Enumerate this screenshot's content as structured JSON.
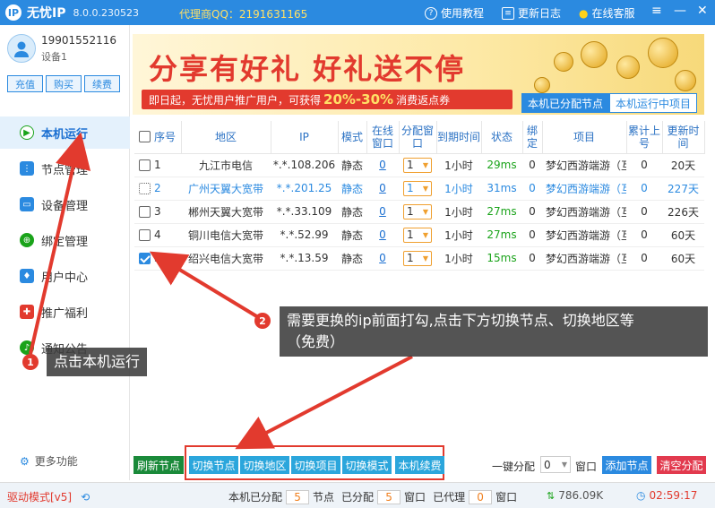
{
  "app": {
    "name": "无忧IP",
    "version": "8.0.0.230523",
    "agent_qq": "代理商QQ：2191631165",
    "tutorial": "使用教程",
    "changelog": "更新日志",
    "support": "在线客服",
    "accent": "#2b8ae0"
  },
  "user": {
    "phone": "19901552116",
    "device": "设备1",
    "buttons": [
      "充值",
      "购买",
      "续费"
    ]
  },
  "nav": [
    {
      "label": "本机运行",
      "icon": "play-icon",
      "active": true
    },
    {
      "label": "节点管理",
      "icon": "node-icon"
    },
    {
      "label": "设备管理",
      "icon": "device-icon"
    },
    {
      "label": "绑定管理",
      "icon": "bind-icon"
    },
    {
      "label": "用户中心",
      "icon": "user-icon"
    },
    {
      "label": "推广福利",
      "icon": "gift-icon"
    },
    {
      "label": "通知公告",
      "icon": "bell-icon"
    }
  ],
  "more_features": "更多功能",
  "banner": {
    "headline": "分享有好礼  好礼送不停",
    "strip_prefix": "即日起，无忧用户推广用户，可获得",
    "strip_pct": "20%-30%",
    "strip_suffix": "消费返点券"
  },
  "tabs": [
    "本机已分配节点",
    "本机运行中项目"
  ],
  "table": {
    "headers": [
      "序号",
      "地区",
      "IP",
      "模式",
      "在线窗口",
      "分配窗口",
      "到期时间",
      "状态",
      "绑定",
      "项目",
      "累计上号",
      "更新时间"
    ],
    "rows": [
      {
        "seq": "1",
        "region": "九江市电信",
        "ip": "*.*.108.206",
        "mode": "静态",
        "online": "0",
        "alloc": "1",
        "expire": "1小时",
        "status": "29ms",
        "bind": "0",
        "project": "梦幻西游端游（互",
        "count": "0",
        "update": "20天",
        "checked": false,
        "hl": false
      },
      {
        "seq": "2",
        "region": "广州天翼大宽带",
        "ip": "*.*.201.25",
        "mode": "静态",
        "online": "0",
        "alloc": "1",
        "expire": "1小时",
        "status": "31ms",
        "bind": "0",
        "project": "梦幻西游端游（互",
        "count": "0",
        "update": "227天",
        "checked": false,
        "hl": true
      },
      {
        "seq": "3",
        "region": "郴州天翼大宽带",
        "ip": "*.*.33.109",
        "mode": "静态",
        "online": "0",
        "alloc": "1",
        "expire": "1小时",
        "status": "27ms",
        "bind": "0",
        "project": "梦幻西游端游（互",
        "count": "0",
        "update": "226天",
        "checked": false,
        "hl": false
      },
      {
        "seq": "4",
        "region": "铜川电信大宽带",
        "ip": "*.*.52.99",
        "mode": "静态",
        "online": "0",
        "alloc": "1",
        "expire": "1小时",
        "status": "27ms",
        "bind": "0",
        "project": "梦幻西游端游（互",
        "count": "0",
        "update": "60天",
        "checked": false,
        "hl": false
      },
      {
        "seq": "5",
        "region": "绍兴电信大宽带",
        "ip": "*.*.13.59",
        "mode": "静态",
        "online": "0",
        "alloc": "1",
        "expire": "1小时",
        "status": "15ms",
        "bind": "0",
        "project": "梦幻西游端游（互",
        "count": "0",
        "update": "60天",
        "checked": true,
        "hl": false
      }
    ]
  },
  "callouts": {
    "one": "点击本机运行",
    "two_line1": "需要更换的ip前面打勾,点击下方切换节点、切换地区等",
    "two_line2": "（免费）",
    "badge1": "1",
    "badge2": "2"
  },
  "controls": {
    "refresh": "刷新节点",
    "switch_node": "切换节点",
    "switch_region": "切换地区",
    "switch_project": "切换项目",
    "switch_mode": "切换模式",
    "renew": "本机续费",
    "one_click": "一键分配",
    "one_click_value": "0",
    "window": "窗口",
    "add_node": "添加节点",
    "clear": "清空分配"
  },
  "status": {
    "driver": "驱动模式[v5]",
    "assigned_label": "本机已分配",
    "assigned_nodes": "5",
    "nodes_label": "节点",
    "alloc_label": "已分配",
    "alloc_windows": "5",
    "window_label": "窗口",
    "proxy_label": "已代理",
    "proxy_windows": "0",
    "window_label2": "窗口",
    "speed": "786.09K",
    "time": "02:59:17"
  }
}
